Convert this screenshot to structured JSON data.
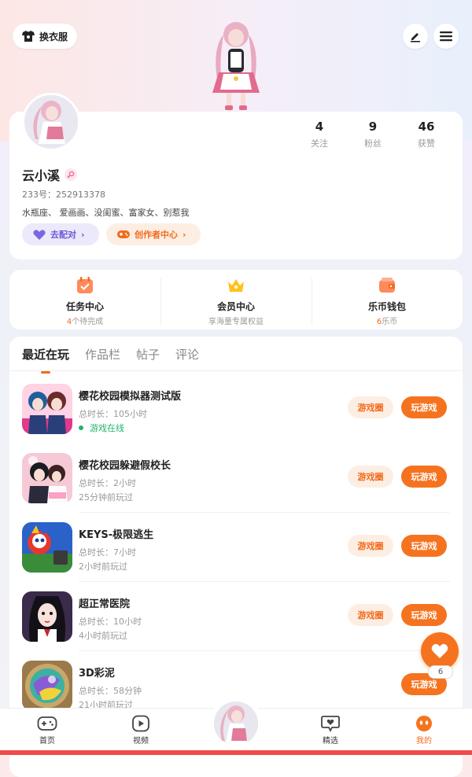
{
  "header": {
    "outfit_label": "换衣服",
    "edit_icon": "pen-icon",
    "menu_icon": "hamburger-icon"
  },
  "profile": {
    "name": "云小溪",
    "uid": "233号：252913378",
    "bio": "水瓶座、 爱画画、没闺蜜、富家女、别惹我",
    "stats": [
      {
        "num": "4",
        "label": "关注"
      },
      {
        "num": "9",
        "label": "粉丝"
      },
      {
        "num": "46",
        "label": "获赞"
      }
    ],
    "pair_label": "去配对",
    "creator_label": "创作者中心"
  },
  "quick": [
    {
      "title": "任务中心",
      "num": "4",
      "sub": "个待完成"
    },
    {
      "title": "会员中心",
      "num": "",
      "sub": "享海量专属权益"
    },
    {
      "title": "乐币钱包",
      "num": "6",
      "sub": "乐币"
    }
  ],
  "tabs": [
    "最近在玩",
    "作品栏",
    "帖子",
    "评论"
  ],
  "games": [
    {
      "title": "樱花校园模拟器测试版",
      "duration": "总时长：105小时",
      "last": "游戏在线",
      "online": true,
      "circle": "游戏圈",
      "play": "玩游戏"
    },
    {
      "title": "樱花校园躲避假校长",
      "duration": "总时长：2小时",
      "last": "25分钟前玩过",
      "online": false,
      "circle": "游戏圈",
      "play": "玩游戏"
    },
    {
      "title": "KEYS-极限逃生",
      "duration": "总时长：7小时",
      "last": "2小时前玩过",
      "online": false,
      "circle": "游戏圈",
      "play": "玩游戏"
    },
    {
      "title": "超正常医院",
      "duration": "总时长：10小时",
      "last": "4小时前玩过",
      "online": false,
      "circle": "游戏圈",
      "play": "玩游戏"
    },
    {
      "title": "3D彩泥",
      "duration": "总时长：58分钟",
      "last": "21小时前玩过",
      "online": false,
      "circle": "",
      "play": "玩游戏"
    }
  ],
  "fab": {
    "badge": "6"
  },
  "nav": [
    {
      "label": "首页",
      "icon": "gamepad-icon"
    },
    {
      "label": "视频",
      "icon": "play-icon"
    },
    {
      "label": "精选",
      "icon": "heart-chat-icon"
    },
    {
      "label": "我的",
      "icon": "face-icon"
    }
  ],
  "colors": {
    "accent": "#f5731f",
    "purple": "#6b5bd6"
  }
}
